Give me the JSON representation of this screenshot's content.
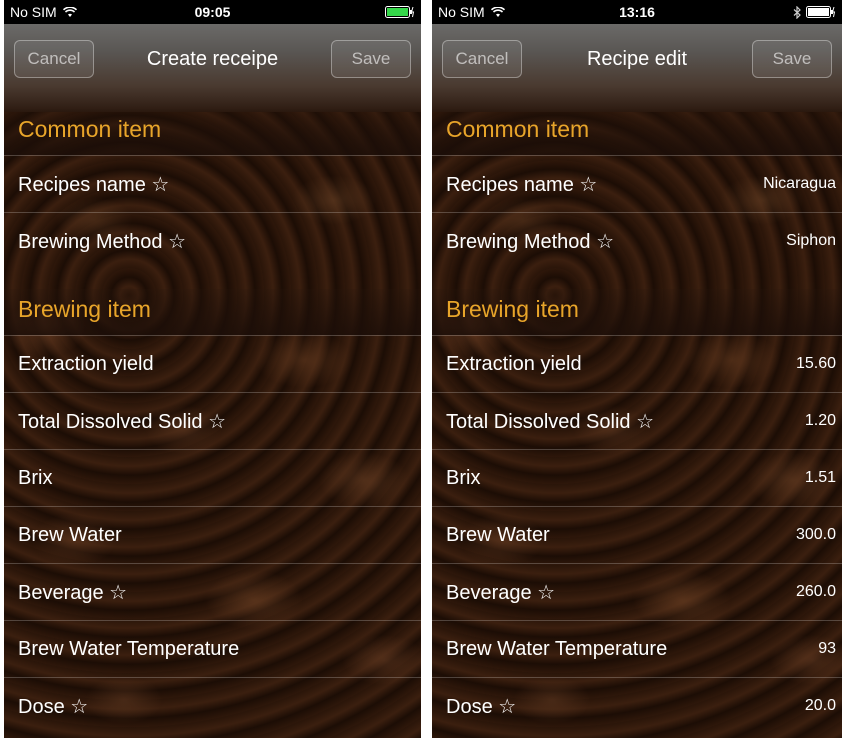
{
  "left": {
    "status": {
      "carrier": "No SIM",
      "time": "09:05"
    },
    "nav": {
      "title": "Create receipe",
      "cancel": "Cancel",
      "save": "Save"
    },
    "sections": {
      "common": "Common item",
      "brewing": "Brewing item"
    },
    "common_rows": [
      {
        "label": "Recipes name ☆",
        "value": ""
      },
      {
        "label": "Brewing Method ☆",
        "value": ""
      }
    ],
    "brewing_rows": [
      {
        "label": "Extraction yield",
        "value": ""
      },
      {
        "label": "Total Dissolved Solid ☆",
        "value": ""
      },
      {
        "label": "Brix",
        "value": ""
      },
      {
        "label": "Brew Water",
        "value": ""
      },
      {
        "label": "Beverage ☆",
        "value": ""
      },
      {
        "label": "Brew Water Temperature",
        "value": ""
      },
      {
        "label": "Dose ☆",
        "value": ""
      }
    ]
  },
  "right": {
    "status": {
      "carrier": "No SIM",
      "time": "13:16"
    },
    "nav": {
      "title": "Recipe edit",
      "cancel": "Cancel",
      "save": "Save"
    },
    "sections": {
      "common": "Common item",
      "brewing": "Brewing item"
    },
    "common_rows": [
      {
        "label": "Recipes name ☆",
        "value": "Nicaragua"
      },
      {
        "label": "Brewing Method ☆",
        "value": "Siphon"
      }
    ],
    "brewing_rows": [
      {
        "label": "Extraction yield",
        "value": "15.60"
      },
      {
        "label": "Total Dissolved Solid ☆",
        "value": "1.20"
      },
      {
        "label": "Brix",
        "value": "1.51"
      },
      {
        "label": "Brew Water",
        "value": "300.0"
      },
      {
        "label": "Beverage ☆",
        "value": "260.0"
      },
      {
        "label": "Brew Water Temperature",
        "value": "93"
      },
      {
        "label": "Dose ☆",
        "value": "20.0"
      }
    ]
  },
  "colors": {
    "section_header": "#e8a52a",
    "battery": "#35d84a"
  },
  "icons": [
    "wifi-icon",
    "battery-icon",
    "bluetooth-icon"
  ]
}
